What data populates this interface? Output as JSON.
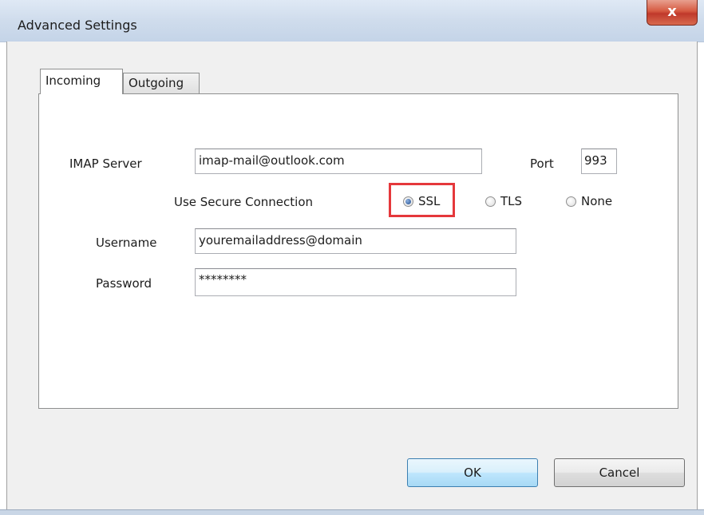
{
  "window": {
    "title": "Advanced Settings",
    "close_symbol": "x"
  },
  "tabs": [
    {
      "label": "Incoming",
      "active": true
    },
    {
      "label": "Outgoing",
      "active": false
    }
  ],
  "form": {
    "server_label": "IMAP Server",
    "server_value": "imap-mail@outlook.com",
    "port_label": "Port",
    "port_value": "993",
    "secure_label": "Use Secure Connection",
    "secure_options": [
      {
        "label": "SSL",
        "checked": true
      },
      {
        "label": "TLS",
        "checked": false
      },
      {
        "label": "None",
        "checked": false
      }
    ],
    "username_label": "Username",
    "username_value": "youremailaddress@domain",
    "password_label": "Password",
    "password_value": "********"
  },
  "buttons": {
    "ok_label": "OK",
    "cancel_label": "Cancel"
  },
  "colors": {
    "highlight": "#e5383b",
    "close_button": "#c0392b"
  },
  "icons": {
    "close": "close-icon",
    "radio": "radio-button"
  }
}
